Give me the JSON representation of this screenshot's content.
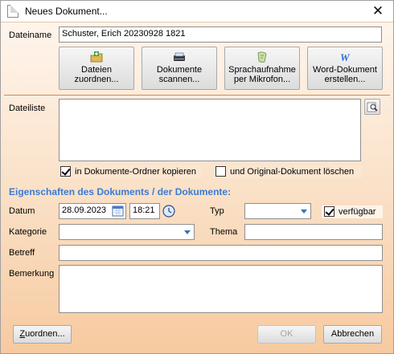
{
  "window": {
    "title": "Neues Dokument..."
  },
  "dateiname": {
    "label": "Dateiname",
    "value": "Schuster, Erich 20230928 1821"
  },
  "actions": [
    {
      "label1": "Dateien",
      "label2": "zuordnen...",
      "icon": "folder-add-icon"
    },
    {
      "label1": "Dokumente",
      "label2": "scannen...",
      "icon": "scanner-icon"
    },
    {
      "label1": "Sprachaufnahme",
      "label2": "per Mikrofon...",
      "icon": "microphone-icon"
    },
    {
      "label1": "Word-Dokument",
      "label2": "erstellen...",
      "icon": "word-icon"
    }
  ],
  "dateiliste": {
    "label": "Dateiliste"
  },
  "options": {
    "copy_label": "in Dokumente-Ordner kopieren",
    "delete_label": "und Original-Dokument löschen",
    "copy_checked": true,
    "delete_checked": false
  },
  "section": {
    "title": "Eigenschaften des Dokuments / der Dokumente:"
  },
  "props": {
    "datum_label": "Datum",
    "datum_value": "28.09.2023",
    "zeit_value": "18:21",
    "typ_label": "Typ",
    "typ_value": "",
    "verfuegbar_label": "verfügbar",
    "verfuegbar_checked": true,
    "kategorie_label": "Kategorie",
    "kategorie_value": "",
    "thema_label": "Thema",
    "thema_value": "",
    "betreff_label": "Betreff",
    "betreff_value": "",
    "bemerkung_label": "Bemerkung",
    "bemerkung_value": ""
  },
  "footer": {
    "zuordnen_label": "Zuordnen...",
    "zuordnen_underline": "Z",
    "ok_label": "OK",
    "abbrechen_label": "Abbrechen"
  },
  "colors": {
    "section_title": "#3a7bd5",
    "dialog_background": "#f7d7b6"
  }
}
